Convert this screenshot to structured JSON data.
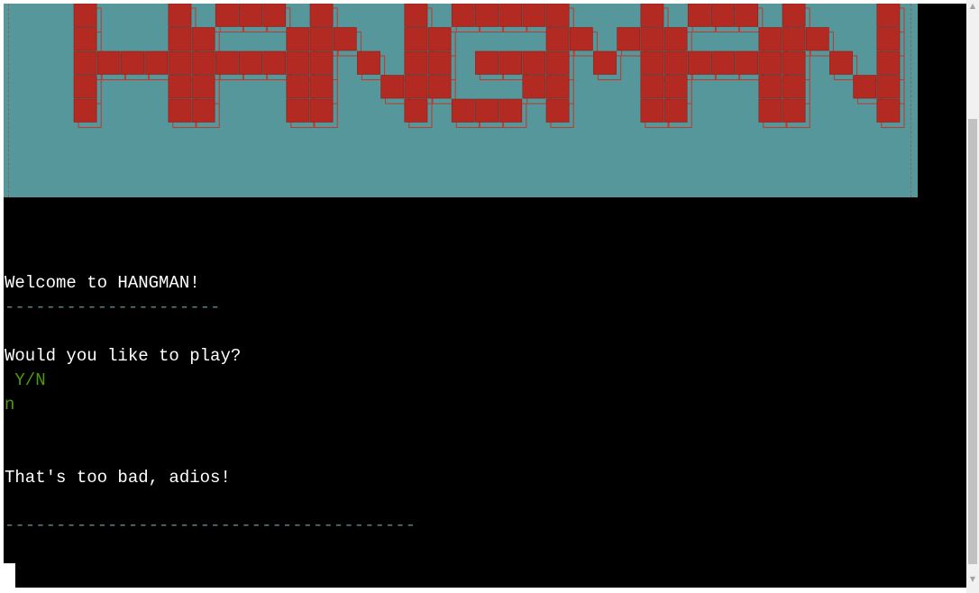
{
  "banner": {
    "art_text": "HANGMAN",
    "colors": {
      "background": "#55979a",
      "block": "#b22a22",
      "outline": "#c0392b"
    }
  },
  "console": {
    "welcome": "Welcome to HANGMAN!",
    "separator_short": "---------------------",
    "prompt": "Would you like to play?",
    "options": " Y/N",
    "user_input": "n",
    "response": "That's too bad, adios!",
    "separator_long": "----------------------------------------"
  },
  "scrollbar": {
    "up_icon": "triangle-up",
    "down_icon": "triangle-down"
  }
}
